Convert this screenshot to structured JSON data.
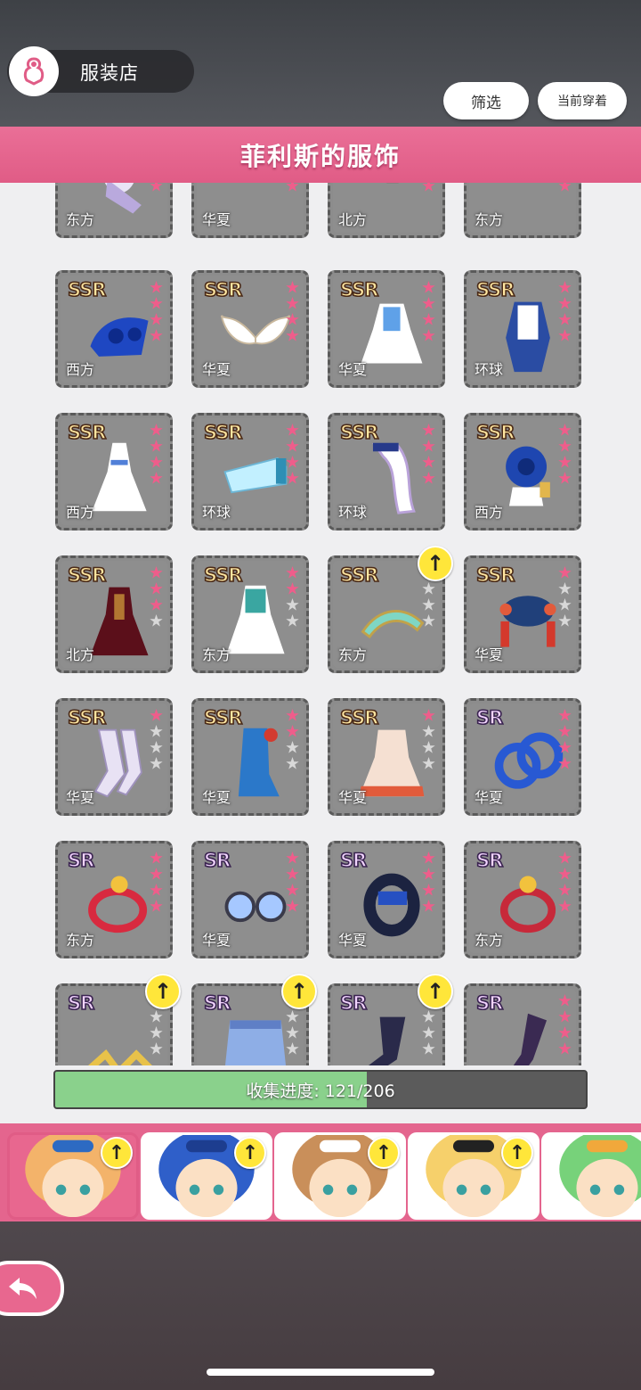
{
  "header": {
    "shop_title": "服装店",
    "filter_label": "筛选",
    "wearing_label": "当前穿着",
    "collection_title": "菲利斯的服饰"
  },
  "colors": {
    "accent": "#e05c86",
    "progress_fill": "#8ad18c",
    "star_on": "#ef5d8b",
    "badge": "#ffe63a"
  },
  "items": [
    {
      "rarity": "",
      "region": "东方",
      "stars": 4,
      "art": "boots-white",
      "up": false
    },
    {
      "rarity": "",
      "region": "华夏",
      "stars": 4,
      "art": "shoes-blue",
      "up": false
    },
    {
      "rarity": "",
      "region": "北方",
      "stars": 4,
      "art": "boots-red",
      "up": false
    },
    {
      "rarity": "",
      "region": "东方",
      "stars": 4,
      "art": "shoes-teal",
      "up": false
    },
    {
      "rarity": "SSR",
      "region": "西方",
      "stars": 4,
      "art": "heels-blue-rose",
      "up": false
    },
    {
      "rarity": "SSR",
      "region": "华夏",
      "stars": 4,
      "art": "wings-white",
      "up": false
    },
    {
      "rarity": "SSR",
      "region": "华夏",
      "stars": 4,
      "art": "dress-white-blue",
      "up": false
    },
    {
      "rarity": "SSR",
      "region": "环球",
      "stars": 4,
      "art": "outfit-blue",
      "up": false
    },
    {
      "rarity": "SSR",
      "region": "西方",
      "stars": 4,
      "art": "gown-white",
      "up": false
    },
    {
      "rarity": "SSR",
      "region": "环球",
      "stars": 4,
      "art": "armband-lightblue",
      "up": false
    },
    {
      "rarity": "SSR",
      "region": "环球",
      "stars": 4,
      "art": "glove-white",
      "up": false
    },
    {
      "rarity": "SSR",
      "region": "西方",
      "stars": 4,
      "art": "rose-corsage",
      "up": false
    },
    {
      "rarity": "SSR",
      "region": "北方",
      "stars": 3,
      "art": "dress-dark-red",
      "up": false
    },
    {
      "rarity": "SSR",
      "region": "东方",
      "stars": 2,
      "art": "dress-teal-white",
      "up": false
    },
    {
      "rarity": "SSR",
      "region": "东方",
      "stars": 0,
      "art": "hairpiece-teal",
      "up": true
    },
    {
      "rarity": "SSR",
      "region": "华夏",
      "stars": 1,
      "art": "headdress-red",
      "up": false
    },
    {
      "rarity": "SSR",
      "region": "华夏",
      "stars": 1,
      "art": "stockings-white",
      "up": false
    },
    {
      "rarity": "SSR",
      "region": "华夏",
      "stars": 2,
      "art": "boots-blue-red",
      "up": false
    },
    {
      "rarity": "SSR",
      "region": "华夏",
      "stars": 1,
      "art": "dress-orange-blue",
      "up": false
    },
    {
      "rarity": "SR",
      "region": "华夏",
      "stars": 4,
      "art": "rings-blue",
      "up": false
    },
    {
      "rarity": "SR",
      "region": "东方",
      "stars": 4,
      "art": "ring-red-gold",
      "up": false
    },
    {
      "rarity": "SR",
      "region": "华夏",
      "stars": 4,
      "art": "glasses-round",
      "up": false
    },
    {
      "rarity": "SR",
      "region": "华夏",
      "stars": 4,
      "art": "bracelet-navy",
      "up": false
    },
    {
      "rarity": "SR",
      "region": "东方",
      "stars": 4,
      "art": "choker-red-bell",
      "up": false
    },
    {
      "rarity": "SR",
      "region": "",
      "stars": 1,
      "art": "hairclips-gold",
      "up": true
    },
    {
      "rarity": "SR",
      "region": "",
      "stars": 1,
      "art": "skirt-denim",
      "up": true
    },
    {
      "rarity": "SR",
      "region": "",
      "stars": 1,
      "art": "socks-navy",
      "up": true
    },
    {
      "rarity": "SR",
      "region": "",
      "stars": 4,
      "art": "stocking-dark",
      "up": false
    }
  ],
  "progress": {
    "label": "收集进度: 121/206",
    "current": 121,
    "total": 206
  },
  "characters": [
    {
      "name": "orange-hair-girl",
      "up": true,
      "selected": true
    },
    {
      "name": "blue-hair-catgirl",
      "up": true,
      "selected": false
    },
    {
      "name": "brown-hair-girl",
      "up": true,
      "selected": false
    },
    {
      "name": "blonde-cap-girl",
      "up": true,
      "selected": false
    },
    {
      "name": "green-hair-girl",
      "up": false,
      "selected": false
    }
  ]
}
